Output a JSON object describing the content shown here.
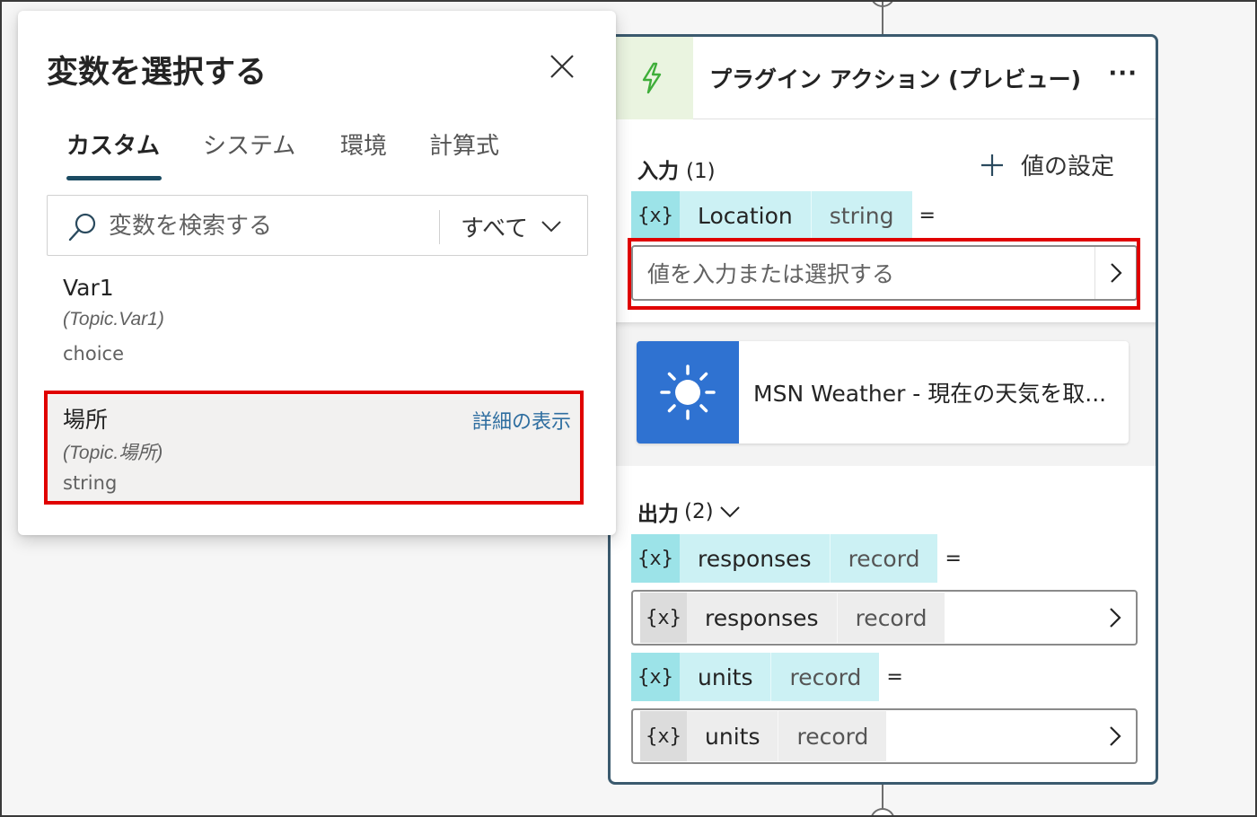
{
  "panel": {
    "title": "変数を選択する",
    "tabs": [
      {
        "label": "カスタム",
        "active": true
      },
      {
        "label": "システム",
        "active": false
      },
      {
        "label": "環境",
        "active": false
      },
      {
        "label": "計算式",
        "active": false
      }
    ],
    "search": {
      "placeholder": "変数を検索する"
    },
    "filter": {
      "label": "すべて"
    },
    "variables": [
      {
        "name": "Var1",
        "path": "(Topic.Var1)",
        "type": "choice"
      },
      {
        "name": "場所",
        "path": "(Topic.場所)",
        "type": "string",
        "detail_link": "詳細の表示",
        "selected": true
      }
    ]
  },
  "card": {
    "title": "プラグイン アクション (プレビュー)",
    "more": "···",
    "input": {
      "label": "入力",
      "count": "(1)",
      "set_value_label": "値の設定",
      "params": [
        {
          "icon": "{x}",
          "name": "Location",
          "type": "string",
          "eq": "=",
          "placeholder": "値を入力または選択する"
        }
      ]
    },
    "plugin": {
      "name": "MSN Weather - 現在の天気を取..."
    },
    "output": {
      "label": "出力",
      "count": "(2)",
      "params": [
        {
          "icon": "{x}",
          "name": "responses",
          "type": "record",
          "eq": "=",
          "value": {
            "icon": "{x}",
            "name": "responses",
            "type": "record"
          }
        },
        {
          "icon": "{x}",
          "name": "units",
          "type": "record",
          "eq": "=",
          "value": {
            "icon": "{x}",
            "name": "units",
            "type": "record"
          }
        }
      ]
    }
  },
  "colors": {
    "highlight": "#e00000",
    "chip": "#ccf1f4",
    "chip_icon": "#9ce3e8",
    "plugin_icon_bg": "#2f72d1",
    "card_border": "#3b5a6e",
    "tab_underline": "#1b4b62",
    "link": "#2f6ea0"
  },
  "icons": [
    "lightning-icon",
    "add-icon",
    "close-icon",
    "search-icon",
    "chevron-down-icon",
    "chevron-right-icon",
    "sun-icon"
  ]
}
